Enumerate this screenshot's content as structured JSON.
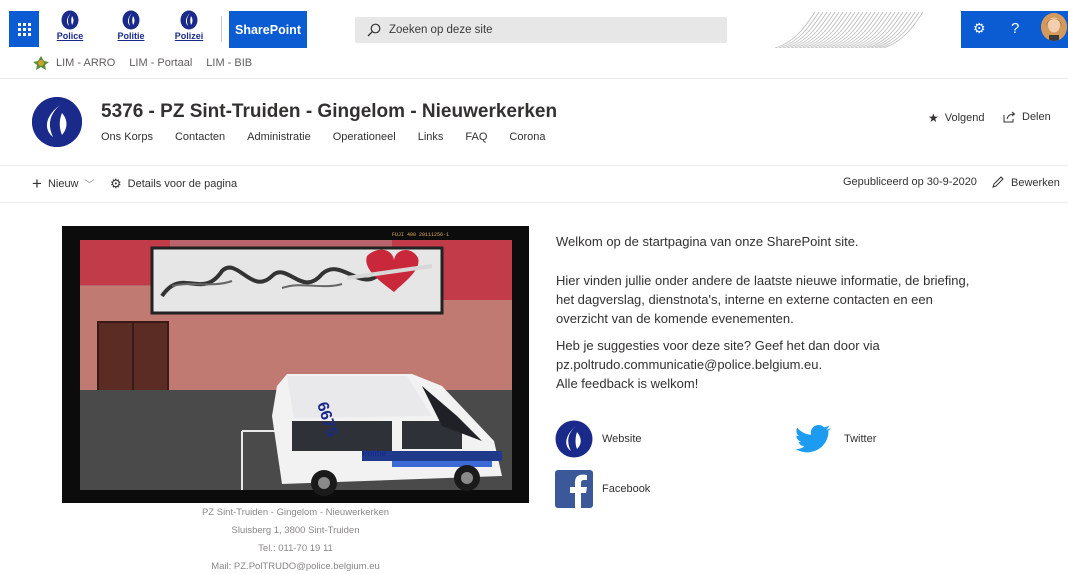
{
  "suite_bar": {
    "brands": [
      {
        "label": "Police"
      },
      {
        "label": "Politie"
      },
      {
        "label": "Polizei"
      }
    ],
    "sharepoint_label": "SharePoint",
    "search_placeholder": "Zoeken op deze site",
    "icons": [
      "waffle-icon",
      "settings-icon",
      "help-icon",
      "avatar"
    ]
  },
  "hub_nav": {
    "items": [
      "LIM - ARRO",
      "LIM - Portaal",
      "LIM - BIB"
    ]
  },
  "site": {
    "title": "5376 - PZ Sint-Truiden - Gingelom - Nieuwerkerken",
    "nav": [
      "Ons Korps",
      "Contacten",
      "Administratie",
      "Operationeel",
      "Links",
      "FAQ",
      "Corona"
    ],
    "follow_label": "Volgend",
    "share_label": "Delen"
  },
  "command_bar": {
    "new_label": "Nieuw",
    "details_label": "Details voor de pagina",
    "published_label": "Gepubliceerd op 30-9-2020",
    "edit_label": "Bewerken"
  },
  "photo": {
    "van_number": "6675",
    "van_text": "Politie",
    "film_code": "FUJI 400 20111256-1"
  },
  "caption": {
    "line1": "PZ Sint-Truiden - Gingelom - Nieuwerkerken",
    "line2": "Sluisberg 1, 3800 Sint-Truiden",
    "line3": "Tel.: 011-70 19 11",
    "line4": "Mail: PZ.PolTRUDO@police.belgium.eu"
  },
  "welcome": {
    "p1": "Welkom op de startpagina van onze SharePoint site.",
    "p2_l1": "Hier vinden jullie onder andere de laatste nieuwe informatie, de briefing,",
    "p2_l2": "het dagverslag, dienstnota's, interne en externe contacten en een",
    "p2_l3": "overzicht van de komende evenementen.",
    "p3_l1": "Heb je suggesties voor deze site?  Geef het dan door via",
    "p3_l2": "pz.poltrudo.communicatie@police.belgium.eu.",
    "p3_l3": "Alle feedback is welkom!"
  },
  "links": {
    "website": "Website",
    "twitter": "Twitter",
    "facebook": "Facebook"
  },
  "colors": {
    "accent": "#0b5bd3",
    "police_navy": "#1a2a8a",
    "twitter": "#1d9bf0",
    "facebook": "#3b5998"
  }
}
